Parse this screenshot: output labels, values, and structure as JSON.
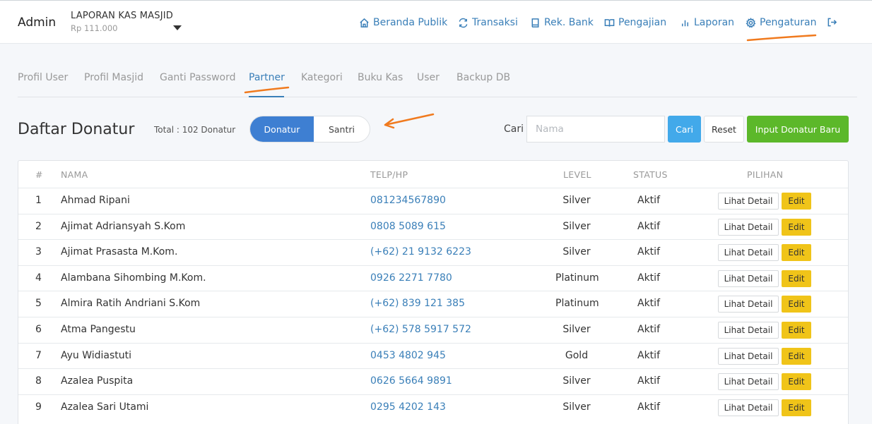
{
  "navbar": {
    "brand": "Admin",
    "org_name": "LAPORAN KAS MASJID",
    "org_balance": "Rp 111.000",
    "items": [
      {
        "label": "Beranda Publik",
        "icon": "home-icon"
      },
      {
        "label": "Transaksi",
        "icon": "refresh-icon"
      },
      {
        "label": "Rek. Bank",
        "icon": "book-icon"
      },
      {
        "label": "Pengajian",
        "icon": "open-book-icon"
      },
      {
        "label": "Laporan",
        "icon": "bar-chart-icon"
      },
      {
        "label": "Pengaturan",
        "icon": "gear-icon"
      }
    ],
    "logout_icon": "logout-icon"
  },
  "tabs": [
    {
      "label": "Profil User",
      "active": false
    },
    {
      "label": "Profil Masjid",
      "active": false
    },
    {
      "label": "Ganti Password",
      "active": false
    },
    {
      "label": "Partner",
      "active": true
    },
    {
      "label": "Kategori",
      "active": false
    },
    {
      "label": "Buku Kas",
      "active": false
    },
    {
      "label": "User",
      "active": false
    },
    {
      "label": "Backup DB",
      "active": false
    }
  ],
  "header": {
    "title": "Daftar Donatur",
    "total": "Total : 102 Donatur",
    "segment": {
      "active": "Donatur",
      "inactive": "Santri"
    },
    "search_label": "Cari",
    "search_placeholder": "Nama",
    "search_value": "",
    "btn_cari": "Cari",
    "btn_reset": "Reset",
    "btn_input": "Input Donatur Baru"
  },
  "table": {
    "columns": [
      "#",
      "NAMA",
      "TELP/HP",
      "LEVEL",
      "STATUS",
      "PILIHAN"
    ],
    "detail_label": "Lihat Detail",
    "edit_label": "Edit",
    "rows": [
      {
        "no": "1",
        "nama": "Ahmad Ripani",
        "telp": "081234567890",
        "level": "Silver",
        "status": "Aktif"
      },
      {
        "no": "2",
        "nama": "Ajimat Adriansyah S.Kom",
        "telp": "0808 5089 615",
        "level": "Silver",
        "status": "Aktif"
      },
      {
        "no": "3",
        "nama": "Ajimat Prasasta M.Kom.",
        "telp": "(+62) 21 9132 6223",
        "level": "Silver",
        "status": "Aktif"
      },
      {
        "no": "4",
        "nama": "Alambana Sihombing M.Kom.",
        "telp": "0926 2271 7780",
        "level": "Platinum",
        "status": "Aktif"
      },
      {
        "no": "5",
        "nama": "Almira Ratih Andriani S.Kom",
        "telp": "(+62) 839 121 385",
        "level": "Platinum",
        "status": "Aktif"
      },
      {
        "no": "6",
        "nama": "Atma Pangestu",
        "telp": "(+62) 578 5917 572",
        "level": "Silver",
        "status": "Aktif"
      },
      {
        "no": "7",
        "nama": "Ayu Widiastuti",
        "telp": "0453 4802 945",
        "level": "Gold",
        "status": "Aktif"
      },
      {
        "no": "8",
        "nama": "Azalea Puspita",
        "telp": "0626 5664 9891",
        "level": "Silver",
        "status": "Aktif"
      },
      {
        "no": "9",
        "nama": "Azalea Sari Utami",
        "telp": "0295 4202 143",
        "level": "Silver",
        "status": "Aktif"
      }
    ]
  },
  "colors": {
    "link_blue": "#3a7fb8",
    "segment_active": "#3e7fd2",
    "btn_cari": "#42a9ea",
    "btn_input": "#5cb82a",
    "btn_edit": "#f0c419",
    "annotation": "#f07a1e"
  }
}
